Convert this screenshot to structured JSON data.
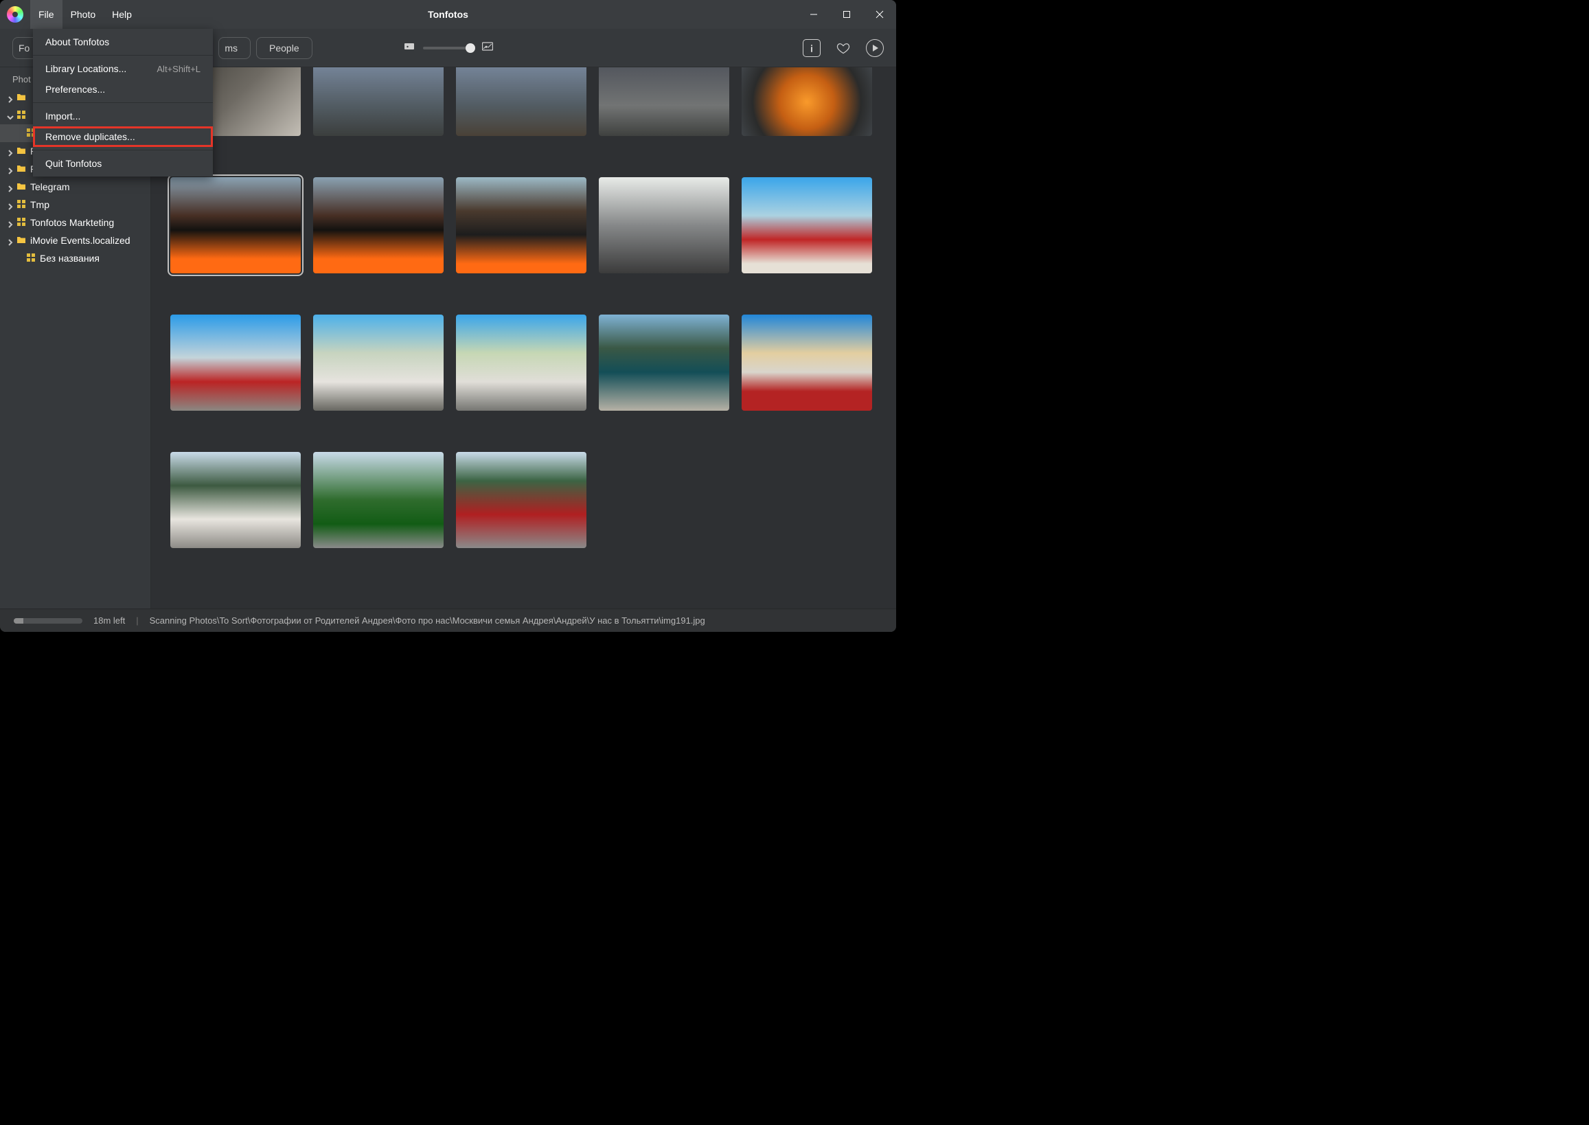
{
  "window": {
    "title": "Tonfotos"
  },
  "menubar": {
    "items": [
      "File",
      "Photo",
      "Help"
    ],
    "active_index": 0
  },
  "file_menu": {
    "about": "About Tonfotos",
    "locations": "Library Locations...",
    "locations_shortcut": "Alt+Shift+L",
    "preferences": "Preferences...",
    "import": "Import...",
    "remove_duplicates": "Remove duplicates...",
    "quit": "Quit Tonfotos"
  },
  "tabs": {
    "folders_partial": "Fo",
    "ms_partial": "ms",
    "people": "People"
  },
  "sidebar": {
    "header": "Phot",
    "items": [
      {
        "label": "",
        "folder": true,
        "level": 0,
        "chev": "right"
      },
      {
        "label": "",
        "grid": true,
        "level": 0,
        "chev": "down"
      },
      {
        "label": "",
        "grid": true,
        "selected": true,
        "level": 1
      },
      {
        "label": "Photos",
        "folder": true,
        "level": 0,
        "chev": "right"
      },
      {
        "label": "Pictures",
        "folder": true,
        "level": 0,
        "chev": "right"
      },
      {
        "label": "Telegram",
        "folder": true,
        "level": 0,
        "chev": "right"
      },
      {
        "label": "Tmp",
        "grid": true,
        "level": 0,
        "chev": "right"
      },
      {
        "label": "Tonfotos Markteting",
        "grid": true,
        "level": 0,
        "chev": "right"
      },
      {
        "label": "iMovie Events.localized",
        "folder": true,
        "level": 0,
        "chev": "right"
      },
      {
        "label": "Без названия",
        "grid": true,
        "level": 1,
        "chev": ""
      }
    ]
  },
  "grid": {
    "row1": [
      "g1",
      "g2",
      "g3",
      "g4",
      "g5"
    ],
    "row2": [
      {
        "c": "g6",
        "sel": true
      },
      {
        "c": "g7"
      },
      {
        "c": "g8"
      },
      {
        "c": "g9"
      },
      {
        "c": "g10"
      }
    ],
    "row3": [
      "g11",
      "g12",
      "g13",
      "g14",
      "g15"
    ],
    "row4": [
      "g16",
      "g17",
      "g18"
    ]
  },
  "statusbar": {
    "time_left": "18m left",
    "scanning": "Scanning Photos\\To Sort\\Фотографии от Родителей Андрея\\Фото про нас\\Москвичи семья Андрея\\Андрей\\У нас в Тольятти\\img191.jpg"
  }
}
